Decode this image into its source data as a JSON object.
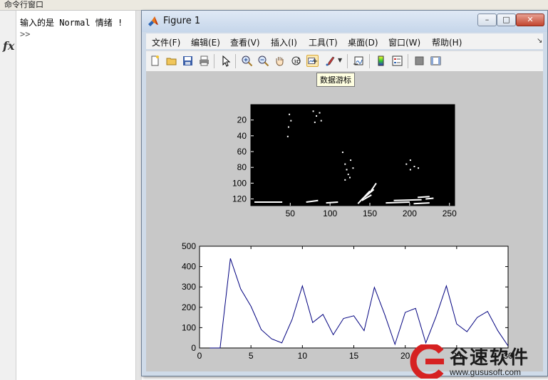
{
  "command_window": {
    "title": "命令行窗口",
    "output_line": "输入的是 Normal 情绪 !",
    "prompt": ">>",
    "fx_label": "fx"
  },
  "figure": {
    "title": "Figure 1",
    "window_buttons": {
      "minimize": "–",
      "maximize": "□",
      "close": "✕"
    },
    "menus": [
      "文件(F)",
      "编辑(E)",
      "查看(V)",
      "插入(I)",
      "工具(T)",
      "桌面(D)",
      "窗口(W)",
      "帮助(H)"
    ],
    "toolbar_icons": [
      "new-file-icon",
      "open-file-icon",
      "save-icon",
      "print-icon",
      "pointer-icon",
      "zoom-in-icon",
      "zoom-out-icon",
      "pan-hand-icon",
      "rotate-3d-icon",
      "data-cursor-icon",
      "brush-icon",
      "link-plot-icon",
      "colorbar-icon",
      "legend-icon",
      "hide-plot-tools-icon",
      "show-plot-tools-icon"
    ],
    "tooltip": "数据游标"
  },
  "chart_data": [
    {
      "type": "heatmap",
      "description_colors": {
        "background": "#000000",
        "foreground": "#ffffff"
      },
      "xticks": [
        50,
        100,
        150,
        200,
        250
      ],
      "yticks": [
        20,
        40,
        60,
        80,
        100,
        120
      ],
      "xlim": [
        0.5,
        256.5
      ],
      "ylim": [
        128.5,
        0.5
      ],
      "y_reversed": true
    },
    {
      "type": "line",
      "color": "#00007f",
      "x": [
        1,
        2,
        3,
        4,
        5,
        6,
        7,
        8,
        9,
        10,
        11,
        12,
        13,
        14,
        15,
        16,
        17,
        18,
        19,
        20,
        21,
        22,
        23,
        24,
        25,
        26,
        27,
        28,
        29,
        30
      ],
      "values": [
        0,
        0,
        440,
        290,
        205,
        90,
        45,
        25,
        140,
        305,
        125,
        165,
        65,
        145,
        158,
        85,
        298,
        165,
        18,
        175,
        195,
        25,
        155,
        305,
        118,
        80,
        150,
        180,
        85,
        10
      ],
      "xticks": [
        0,
        5,
        10,
        15,
        20,
        25,
        30
      ],
      "yticks": [
        0,
        100,
        200,
        300,
        400,
        500
      ],
      "xlim": [
        0,
        30
      ],
      "ylim": [
        0,
        500
      ]
    }
  ],
  "watermark": {
    "text": "谷速软件",
    "url": "www.gususoft.com",
    "accent_color": "#d62121"
  }
}
